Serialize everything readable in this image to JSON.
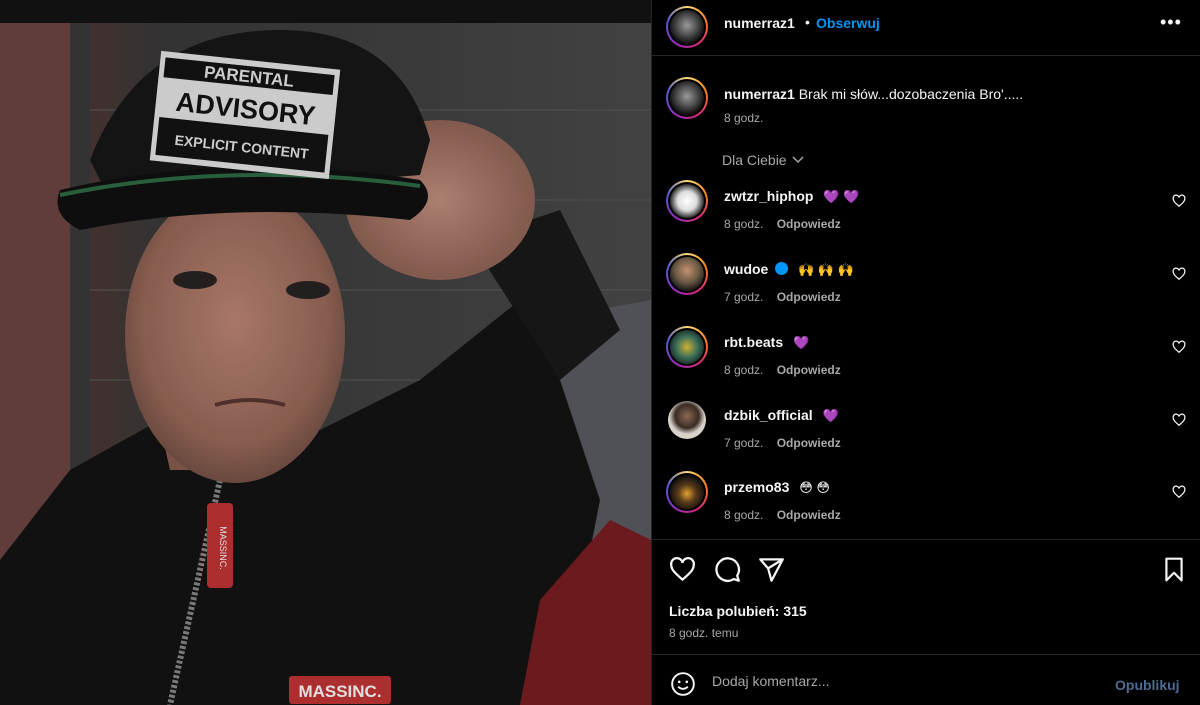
{
  "post": {
    "username": "numerraz1",
    "separator": "•",
    "follow_label": "Obserwuj",
    "more_icon": "more-horizontal-icon"
  },
  "caption": {
    "username": "numerraz1",
    "text": "Brak mi słów...dozobaczenia Bro'.....",
    "time": "8 godz."
  },
  "photo": {
    "cap_line1": "PARENTAL",
    "cap_line2": "ADVISORY",
    "cap_line3": "EXPLICIT CONTENT",
    "zip_tag": "MASSINC.",
    "chest_label": "MASSINC."
  },
  "filter": {
    "label": "Dla Ciebie",
    "icon": "chevron-down-icon"
  },
  "comments": [
    {
      "username": "zwtzr_hiphop",
      "text": "💜 💜",
      "time": "8 godz.",
      "reply": "Odpowiedz",
      "verified": false,
      "avatar_color": "#e8e8e8"
    },
    {
      "username": "wudoe",
      "text": "🙌 🙌 🙌",
      "time": "7 godz.",
      "reply": "Odpowiedz",
      "verified": true,
      "avatar_color": "#6b5a45"
    },
    {
      "username": "rbt.beats",
      "text": "💜",
      "time": "8 godz.",
      "reply": "Odpowiedz",
      "verified": false,
      "avatar_color": "#3a6e5a"
    },
    {
      "username": "dzbik_official",
      "text": "💜",
      "time": "7 godz.",
      "reply": "Odpowiedz",
      "verified": false,
      "avatar_color": "#d8d2c8"
    },
    {
      "username": "przemo83",
      "text": "😳 😳",
      "time": "8 godz.",
      "reply": "Odpowiedz",
      "verified": false,
      "avatar_color": "#2b2418"
    }
  ],
  "stats": {
    "likes": "Liczba polubień: 315",
    "time_ago": "8 godz. temu"
  },
  "add_comment": {
    "placeholder": "Dodaj komentarz...",
    "publish_label": "Opublikuj"
  },
  "colors": {
    "accent": "#0095f6",
    "muted": "#a8a8a8",
    "border": "#262626"
  }
}
